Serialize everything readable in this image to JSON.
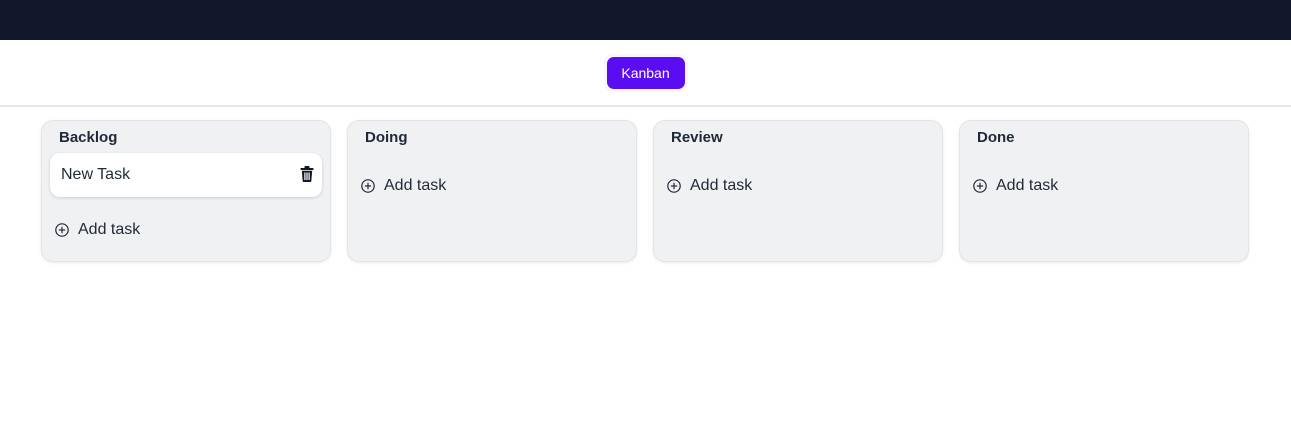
{
  "view_switcher": {
    "kanban_label": "Kanban"
  },
  "columns": [
    {
      "title": "Backlog",
      "cards": [
        {
          "title": "New Task"
        }
      ],
      "add_label": "Add task"
    },
    {
      "title": "Doing",
      "cards": [],
      "add_label": "Add task"
    },
    {
      "title": "Review",
      "cards": [],
      "add_label": "Add task"
    },
    {
      "title": "Done",
      "cards": [],
      "add_label": "Add task"
    }
  ],
  "icons": {
    "delete": "trash-icon",
    "add": "plus-circle-icon"
  },
  "colors": {
    "topbar": "#12172b",
    "accent": "#5b0df1",
    "column_bg": "#f0f1f3"
  }
}
